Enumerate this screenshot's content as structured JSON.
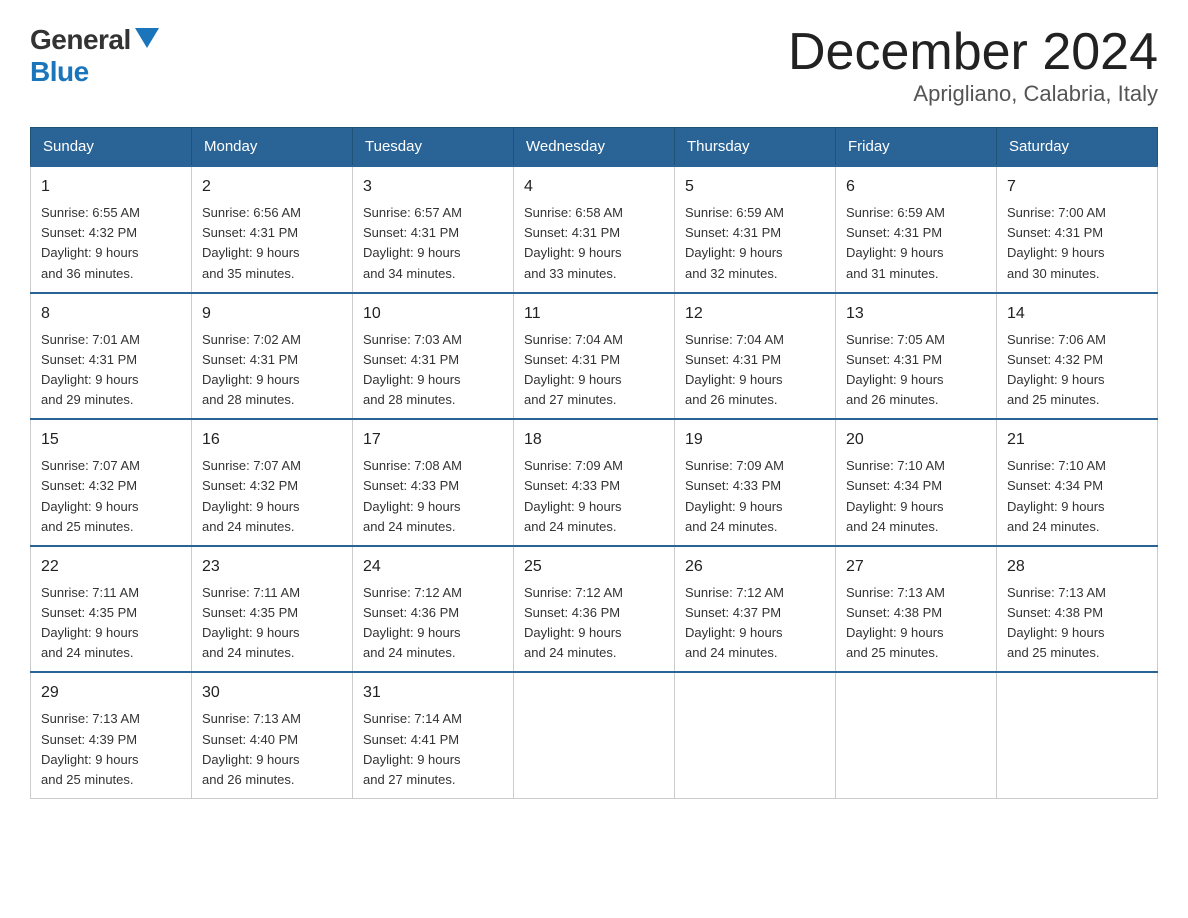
{
  "logo": {
    "general": "General",
    "blue": "Blue"
  },
  "title": "December 2024",
  "subtitle": "Aprigliano, Calabria, Italy",
  "days_of_week": [
    "Sunday",
    "Monday",
    "Tuesday",
    "Wednesday",
    "Thursday",
    "Friday",
    "Saturday"
  ],
  "weeks": [
    [
      {
        "day": "1",
        "sunrise": "6:55 AM",
        "sunset": "4:32 PM",
        "daylight": "9 hours and 36 minutes."
      },
      {
        "day": "2",
        "sunrise": "6:56 AM",
        "sunset": "4:31 PM",
        "daylight": "9 hours and 35 minutes."
      },
      {
        "day": "3",
        "sunrise": "6:57 AM",
        "sunset": "4:31 PM",
        "daylight": "9 hours and 34 minutes."
      },
      {
        "day": "4",
        "sunrise": "6:58 AM",
        "sunset": "4:31 PM",
        "daylight": "9 hours and 33 minutes."
      },
      {
        "day": "5",
        "sunrise": "6:59 AM",
        "sunset": "4:31 PM",
        "daylight": "9 hours and 32 minutes."
      },
      {
        "day": "6",
        "sunrise": "6:59 AM",
        "sunset": "4:31 PM",
        "daylight": "9 hours and 31 minutes."
      },
      {
        "day": "7",
        "sunrise": "7:00 AM",
        "sunset": "4:31 PM",
        "daylight": "9 hours and 30 minutes."
      }
    ],
    [
      {
        "day": "8",
        "sunrise": "7:01 AM",
        "sunset": "4:31 PM",
        "daylight": "9 hours and 29 minutes."
      },
      {
        "day": "9",
        "sunrise": "7:02 AM",
        "sunset": "4:31 PM",
        "daylight": "9 hours and 28 minutes."
      },
      {
        "day": "10",
        "sunrise": "7:03 AM",
        "sunset": "4:31 PM",
        "daylight": "9 hours and 28 minutes."
      },
      {
        "day": "11",
        "sunrise": "7:04 AM",
        "sunset": "4:31 PM",
        "daylight": "9 hours and 27 minutes."
      },
      {
        "day": "12",
        "sunrise": "7:04 AM",
        "sunset": "4:31 PM",
        "daylight": "9 hours and 26 minutes."
      },
      {
        "day": "13",
        "sunrise": "7:05 AM",
        "sunset": "4:31 PM",
        "daylight": "9 hours and 26 minutes."
      },
      {
        "day": "14",
        "sunrise": "7:06 AM",
        "sunset": "4:32 PM",
        "daylight": "9 hours and 25 minutes."
      }
    ],
    [
      {
        "day": "15",
        "sunrise": "7:07 AM",
        "sunset": "4:32 PM",
        "daylight": "9 hours and 25 minutes."
      },
      {
        "day": "16",
        "sunrise": "7:07 AM",
        "sunset": "4:32 PM",
        "daylight": "9 hours and 24 minutes."
      },
      {
        "day": "17",
        "sunrise": "7:08 AM",
        "sunset": "4:33 PM",
        "daylight": "9 hours and 24 minutes."
      },
      {
        "day": "18",
        "sunrise": "7:09 AM",
        "sunset": "4:33 PM",
        "daylight": "9 hours and 24 minutes."
      },
      {
        "day": "19",
        "sunrise": "7:09 AM",
        "sunset": "4:33 PM",
        "daylight": "9 hours and 24 minutes."
      },
      {
        "day": "20",
        "sunrise": "7:10 AM",
        "sunset": "4:34 PM",
        "daylight": "9 hours and 24 minutes."
      },
      {
        "day": "21",
        "sunrise": "7:10 AM",
        "sunset": "4:34 PM",
        "daylight": "9 hours and 24 minutes."
      }
    ],
    [
      {
        "day": "22",
        "sunrise": "7:11 AM",
        "sunset": "4:35 PM",
        "daylight": "9 hours and 24 minutes."
      },
      {
        "day": "23",
        "sunrise": "7:11 AM",
        "sunset": "4:35 PM",
        "daylight": "9 hours and 24 minutes."
      },
      {
        "day": "24",
        "sunrise": "7:12 AM",
        "sunset": "4:36 PM",
        "daylight": "9 hours and 24 minutes."
      },
      {
        "day": "25",
        "sunrise": "7:12 AM",
        "sunset": "4:36 PM",
        "daylight": "9 hours and 24 minutes."
      },
      {
        "day": "26",
        "sunrise": "7:12 AM",
        "sunset": "4:37 PM",
        "daylight": "9 hours and 24 minutes."
      },
      {
        "day": "27",
        "sunrise": "7:13 AM",
        "sunset": "4:38 PM",
        "daylight": "9 hours and 25 minutes."
      },
      {
        "day": "28",
        "sunrise": "7:13 AM",
        "sunset": "4:38 PM",
        "daylight": "9 hours and 25 minutes."
      }
    ],
    [
      {
        "day": "29",
        "sunrise": "7:13 AM",
        "sunset": "4:39 PM",
        "daylight": "9 hours and 25 minutes."
      },
      {
        "day": "30",
        "sunrise": "7:13 AM",
        "sunset": "4:40 PM",
        "daylight": "9 hours and 26 minutes."
      },
      {
        "day": "31",
        "sunrise": "7:14 AM",
        "sunset": "4:41 PM",
        "daylight": "9 hours and 27 minutes."
      },
      null,
      null,
      null,
      null
    ]
  ],
  "labels": {
    "sunrise": "Sunrise:",
    "sunset": "Sunset:",
    "daylight": "Daylight:"
  }
}
